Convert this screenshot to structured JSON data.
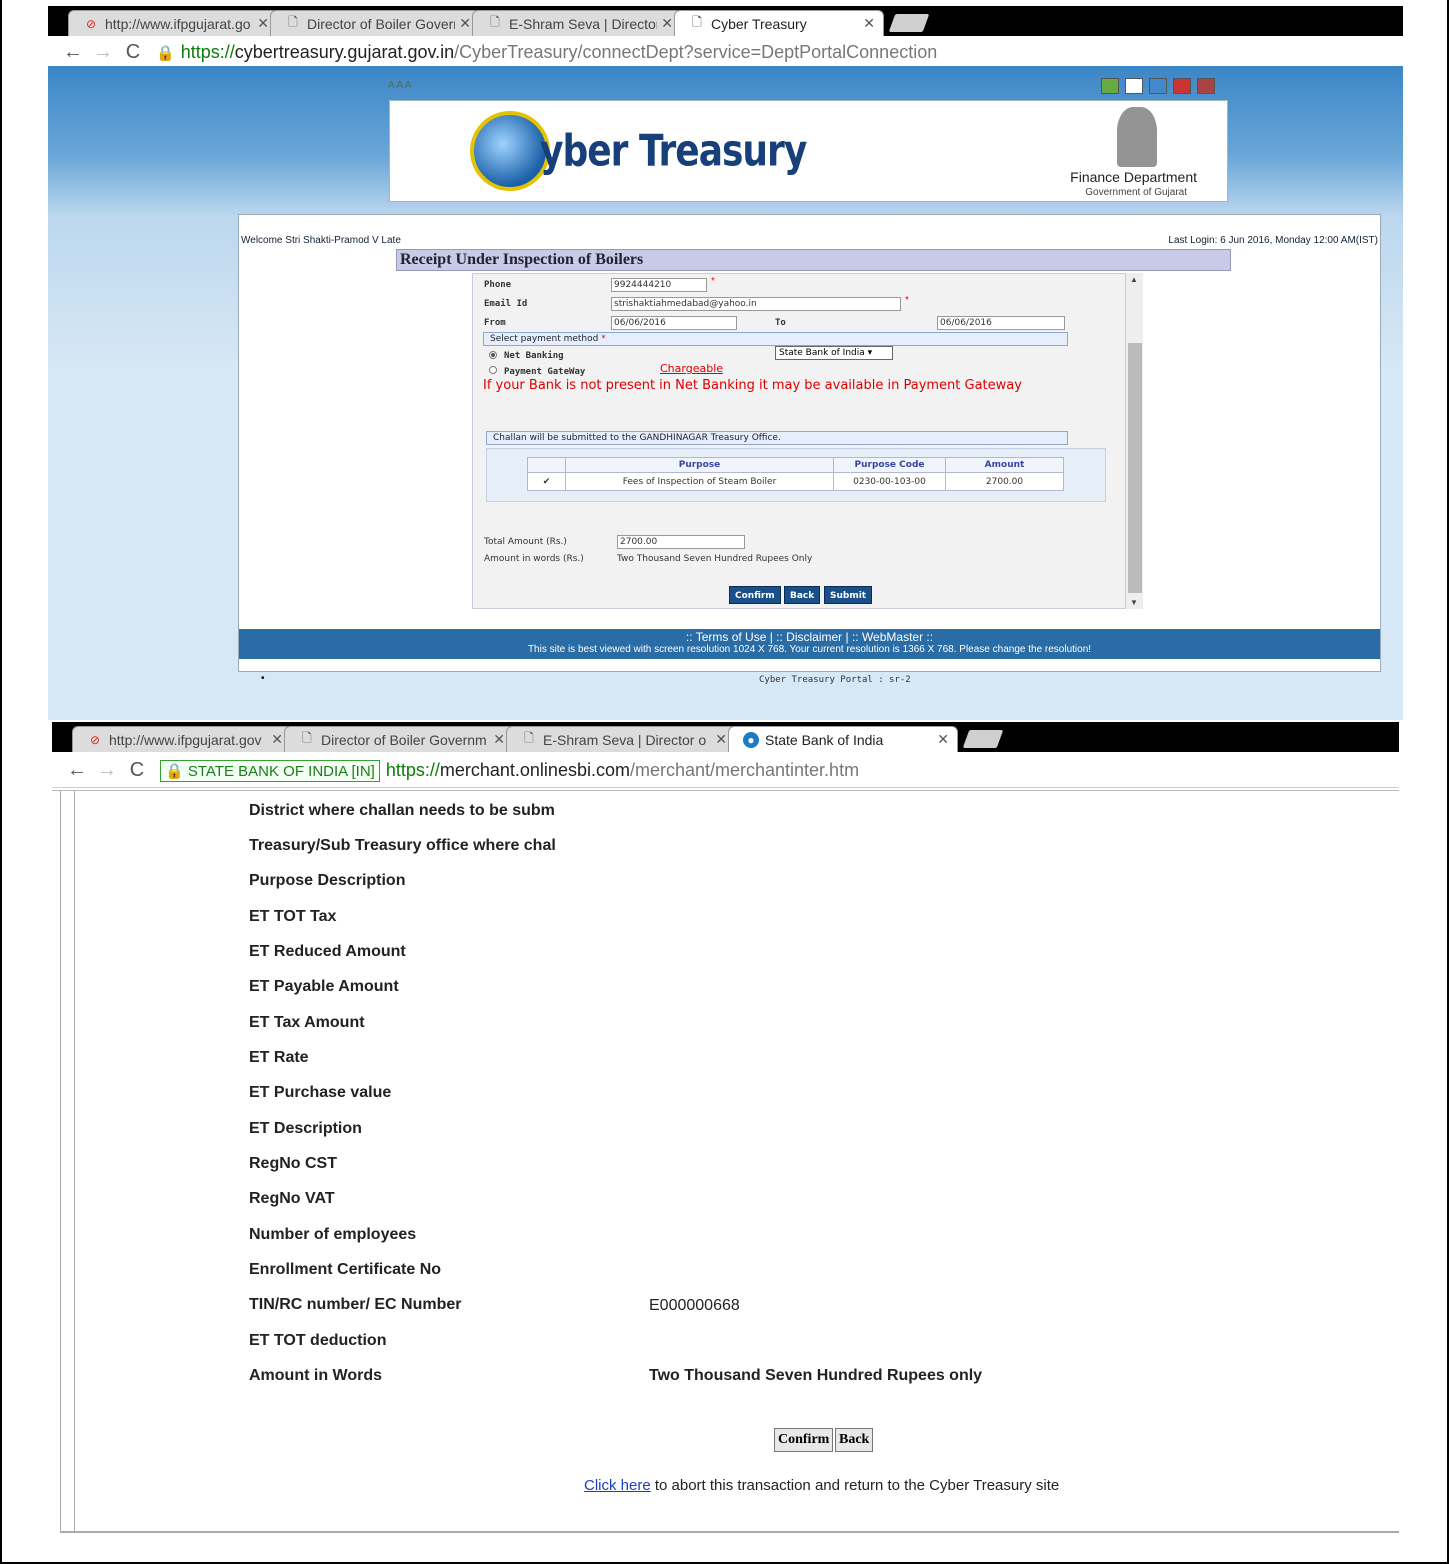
{
  "browser1": {
    "tabs": [
      {
        "title": "http://www.ifpgujarat.go",
        "icon": "opera-icon"
      },
      {
        "title": "Director of Boiler Governo",
        "icon": "page-icon"
      },
      {
        "title": "E-Shram Seva | Director o",
        "icon": "page-icon"
      },
      {
        "title": "Cyber Treasury",
        "icon": "page-icon",
        "active": true
      }
    ],
    "url_scheme": "https://",
    "url_host": "cybertreasury.gujarat.gov.in",
    "url_path": "/CyberTreasury/connectDept?service=DeptPortalConnection"
  },
  "cyber_treasury": {
    "aaa": "A A A",
    "logo_text": "yber Treasury",
    "dept": "Finance Department",
    "gov": "Government of Gujarat",
    "welcome": "Welcome Stri Shakti-Pramod V Late",
    "last_login": "Last Login: 6 Jun 2016, Monday 12:00 AM(IST)",
    "title": "Receipt Under Inspection of Boilers",
    "phone_label": "Phone",
    "phone": "9924444210",
    "email_label": "Email Id",
    "email": "strishaktiahmedabad@yahoo.in",
    "from_label": "From",
    "from": "06/06/2016",
    "to_label": "To",
    "to": "06/06/2016",
    "payment_section": "Select payment method",
    "net_banking": "Net Banking",
    "payment_gateway": "Payment GateWay",
    "bank_selected": "State Bank of India",
    "chargeable": "Chargeable",
    "warning": "If your Bank is not present in Net Banking it may be available in Payment Gateway",
    "challan_section": "Challan will be submitted to the GANDHINAGAR Treasury Office.",
    "table": {
      "headers": [
        "Purpose",
        "Purpose Code",
        "Amount"
      ],
      "rows": [
        {
          "checked": "✔",
          "purpose": "Fees of Inspection of Steam Boiler",
          "code": "0230-00-103-00",
          "amount": "2700.00"
        }
      ]
    },
    "total_label": "Total Amount (Rs.)",
    "total": "2700.00",
    "words_label": "Amount in words (Rs.)",
    "words": "Two Thousand Seven Hundred Rupees Only",
    "buttons": {
      "confirm": "Confirm",
      "back": "Back",
      "submit": "Submit"
    },
    "footer_links": ":: Terms of Use | :: Disclaimer | :: WebMaster ::",
    "footer_note": "This site is best viewed with screen resolution 1024 X 768. Your current resolution is 1366 X 768. Please change the resolution!",
    "portal": "Cyber Treasury Portal : sr-2"
  },
  "browser2": {
    "tabs": [
      {
        "title": "http://www.ifpgujarat.gov",
        "icon": "opera-icon"
      },
      {
        "title": "Director of Boiler Governm",
        "icon": "page-icon"
      },
      {
        "title": "E-Shram Seva | Director o",
        "icon": "page-icon"
      },
      {
        "title": "State Bank of India",
        "icon": "sbi-icon",
        "active": true
      }
    ],
    "ev_badge": "STATE BANK OF INDIA [IN]",
    "url_scheme": "https://",
    "url_host": "merchant.onlinesbi.com",
    "url_path": "/merchant/merchantinter.htm"
  },
  "sbi": {
    "rows": [
      {
        "label": "District where challan needs to be subm",
        "value": ""
      },
      {
        "label": "Treasury/Sub Treasury office where chal",
        "value": ""
      },
      {
        "label": "Purpose Description",
        "value": ""
      },
      {
        "label": "ET TOT Tax",
        "value": ""
      },
      {
        "label": "ET Reduced Amount",
        "value": ""
      },
      {
        "label": "ET Payable Amount",
        "value": ""
      },
      {
        "label": "ET Tax Amount",
        "value": ""
      },
      {
        "label": "ET Rate",
        "value": ""
      },
      {
        "label": "ET Purchase value",
        "value": ""
      },
      {
        "label": "ET Description",
        "value": ""
      },
      {
        "label": "RegNo CST",
        "value": ""
      },
      {
        "label": "RegNo VAT",
        "value": ""
      },
      {
        "label": "Number of employees",
        "value": ""
      },
      {
        "label": "Enrollment Certificate No",
        "value": ""
      },
      {
        "label": "TIN/RC number/ EC Number",
        "value": "E000000668"
      },
      {
        "label": "ET TOT deduction",
        "value": ""
      },
      {
        "label": "Amount in Words",
        "value": "Two Thousand Seven Hundred Rupees only"
      }
    ],
    "confirm": "Confirm",
    "back": "Back",
    "abort_link": "Click here",
    "abort_text": " to abort this transaction and return to the Cyber Treasury site"
  }
}
